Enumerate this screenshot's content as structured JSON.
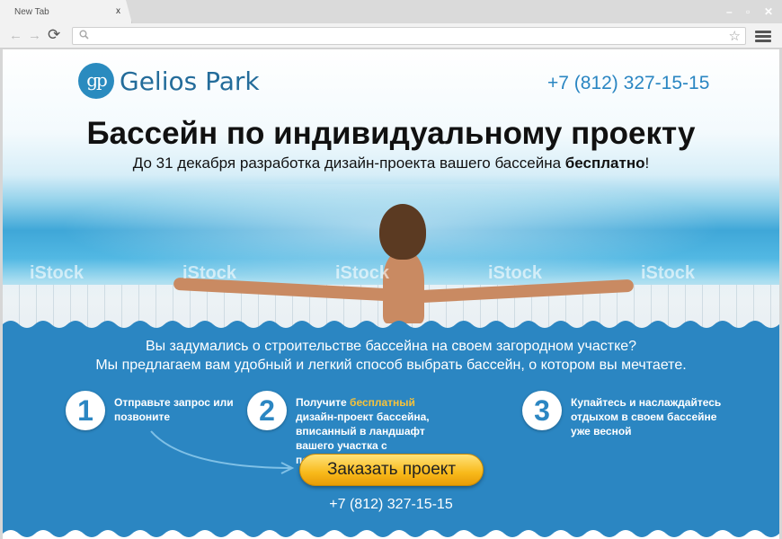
{
  "browser": {
    "tab_title": "New Tab",
    "tab_close": "x",
    "minimize": "–",
    "maximize": "▫",
    "close": "✕",
    "back": "←",
    "forward": "→",
    "reload": "⟳",
    "search_icon": "🔍",
    "star": "☆",
    "address_value": ""
  },
  "page": {
    "logo_mark": "gp",
    "brand": "Gelios Park",
    "phone": "+7 (812) 327-15-15",
    "headline": "Бассейн по индивидуальному проекту",
    "sub_before": "До 31 декабря разработка дизайн-проекта вашего бассейна ",
    "sub_bold": "бесплатно",
    "sub_after": "!",
    "watermarks": [
      "iStock",
      "iStock",
      "iStock",
      "iStock",
      "iStock"
    ],
    "intro_line1": "Вы задумались о строительстве бассейна на своем загородном участке?",
    "intro_line2": "Мы предлагаем вам удобный и легкий способ выбрать бассейн, о котором вы мечтаете.",
    "steps": [
      {
        "num": "1",
        "text": "Отправьте запрос или позвоните"
      },
      {
        "num": "2",
        "before": "Получите ",
        "highlight": "бесплатный",
        "after": " дизайн-проект бассейна, вписанный в ландшафт вашего участка с подробной сметой"
      },
      {
        "num": "3",
        "text": "Купайтесь и наслаждайтесь отдыхом в своем бассейне уже весной"
      }
    ],
    "cta": "Заказать проект",
    "phone_bottom": "+7 (812) 327-15-15"
  },
  "colors": {
    "accent_blue": "#2b86c2",
    "highlight": "#f7c23a",
    "cta_orange": "#f8b91a"
  }
}
